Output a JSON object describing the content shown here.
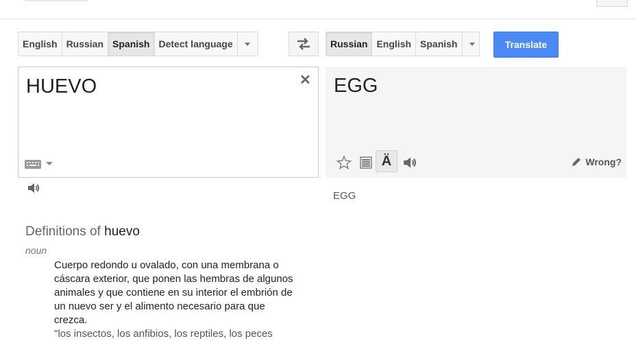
{
  "source": {
    "languages": [
      "English",
      "Russian",
      "Spanish",
      "Detect language"
    ],
    "active_index": 2,
    "text": "HUEVO"
  },
  "target": {
    "languages": [
      "Russian",
      "English",
      "Spanish"
    ],
    "active_index": 0,
    "text": "EGG",
    "alternative": "EGG",
    "wrong_label": "Wrong?",
    "phonetic_glyph": "Ä"
  },
  "translate_button": "Translate",
  "clear_glyph": "✕",
  "definitions": {
    "title_prefix": "Definitions of",
    "word": "huevo",
    "part_of_speech": "noun",
    "text": "Cuerpo redondo u ovalado, con una membrana o cáscara exterior, que ponen las hembras de algunos animales y que contiene en su interior el embrión de un nuevo ser y el alimento necesario para que crezca.",
    "example": "\"los insectos, los anfibios, los reptiles, los peces"
  },
  "colors": {
    "accent": "#4a8af4",
    "target_bg": "#f5f5f5",
    "active_lang_bg": "#e6e6e6"
  },
  "icons": [
    "swap-icon",
    "close-icon",
    "keyboard-icon",
    "speaker-icon",
    "star-icon",
    "list-icon",
    "pencil-icon"
  ]
}
